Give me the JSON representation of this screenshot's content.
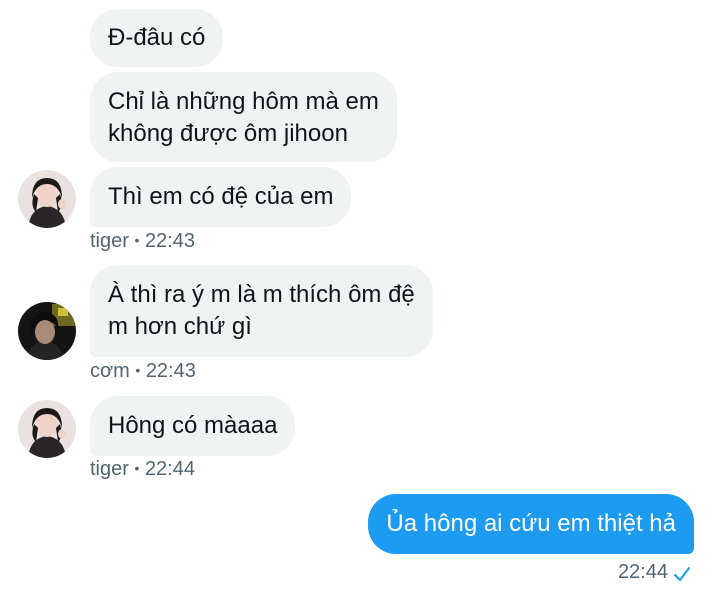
{
  "conversation": {
    "messages": [
      {
        "lines": [
          "Đ-đâu có"
        ]
      },
      {
        "lines": [
          "Chỉ là những hôm mà em",
          "không được ôm jihoon"
        ]
      },
      {
        "lines": [
          "Thì em có đệ của em"
        ],
        "sender": "tiger",
        "time": "22:43",
        "avatar": "girl-photo-avatar"
      },
      {
        "lines": [
          "À thì ra ý m là m thích ôm đệ",
          "m hơn chứ gì"
        ],
        "sender": "cơm",
        "time": "22:43",
        "avatar": "boy-photo-avatar"
      },
      {
        "lines": [
          "Hông có màaaa"
        ],
        "sender": "tiger",
        "time": "22:44",
        "avatar": "girl-photo-avatar"
      },
      {
        "lines": [
          "Ủa hông ai cứu em thiệt hả"
        ],
        "time": "22:44",
        "outgoing": true,
        "status_icon": "sent-check-icon"
      }
    ],
    "meta_separator": "•"
  },
  "colors": {
    "incoming_bubble": "#eff3f4",
    "outgoing_bubble": "#1d9bf0",
    "meta_text": "#536471",
    "check": "#1d9bf0"
  }
}
